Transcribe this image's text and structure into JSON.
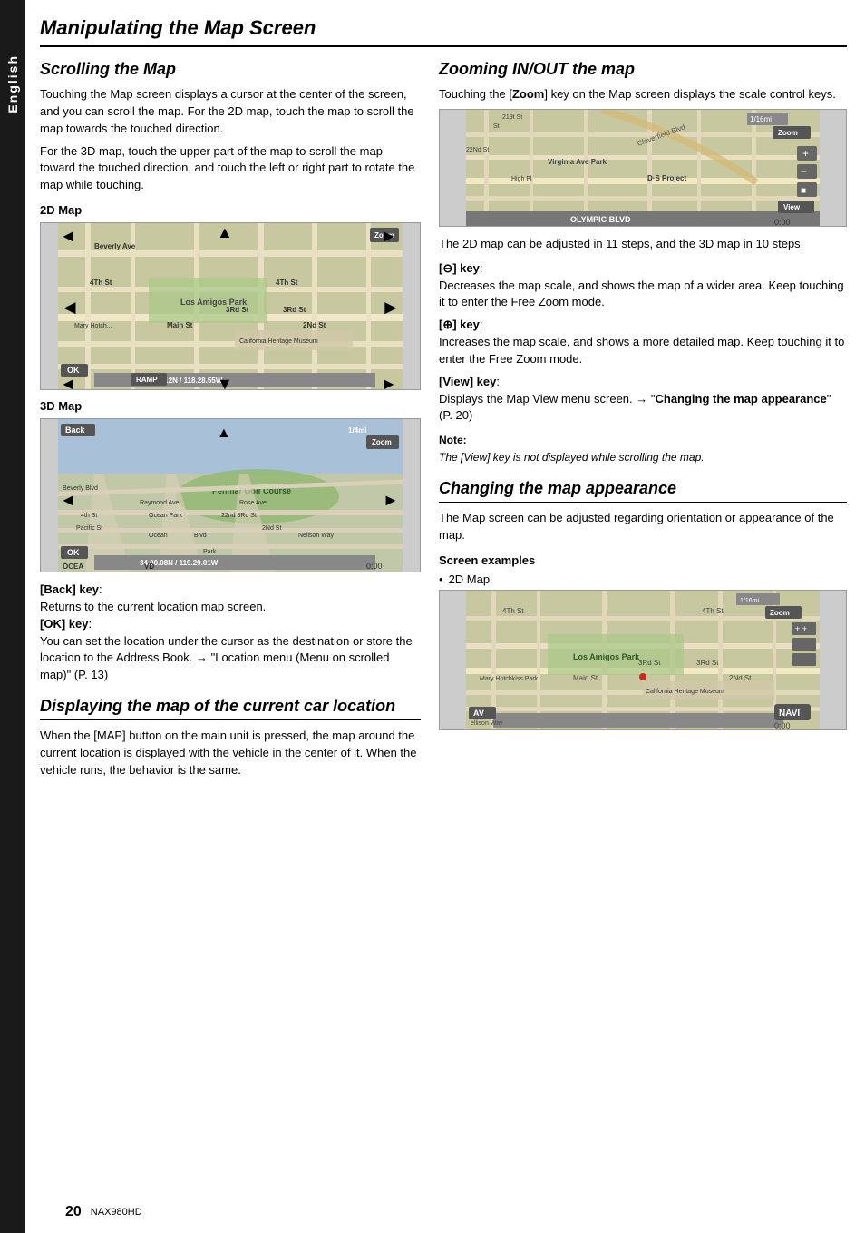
{
  "page": {
    "title": "Manipulating the Map Screen",
    "page_number": "20",
    "model": "NAX980HD"
  },
  "side_tab": {
    "label": "English"
  },
  "left_column": {
    "scrolling_title": "Scrolling the Map",
    "scrolling_text": "Touching the Map screen displays a cursor at the center of the screen, and you can scroll the map. For the 2D map, touch the map to scroll the map towards the touched direction.",
    "scrolling_text2": "For the 3D map, touch the upper part of the map to scroll the map toward the touched direction, and touch the left or right part to rotate the map while touching.",
    "map_2d_label": "2D Map",
    "map_3d_label": "3D Map",
    "back_key_label": "[Back] key",
    "back_key_text": "Returns to the current location map screen.",
    "ok_key_label": "[OK] key",
    "ok_key_text": "You can set the location under the cursor as the destination or store the location to the Address Book. → \"Location menu (Menu on scrolled map)\" (P. 13)",
    "displaying_title": "Displaying the map of the current car location",
    "displaying_text": "When the [MAP] button on the main unit is pressed, the map around the current location is displayed with the vehicle in the center of it. When the vehicle runs, the behavior is the same."
  },
  "right_column": {
    "zooming_title": "Zooming IN/OUT the map",
    "zooming_text": "Touching the [Zoom] key on the Map screen displays the scale control keys.",
    "zooming_text2": "The 2D map can be adjusted in 11 steps, and the 3D map in 10 steps.",
    "minus_key_label": "[⊖] key",
    "minus_key_text": "Decreases the map scale, and shows the map of a wider area. Keep touching it to enter the Free Zoom mode.",
    "plus_key_label": "[⊕] key",
    "plus_key_text": "Increases the map scale, and shows a more detailed map. Keep touching it to enter the Free Zoom mode.",
    "view_key_label": "[View] key",
    "view_key_text": "Displays the Map View menu screen. → \"Changing the map appearance\" (P. 20)",
    "note_title": "Note:",
    "note_text": "The [View] key is not displayed while scrolling the map.",
    "changing_title": "Changing the map appearance",
    "changing_text": "The Map screen can be adjusted regarding orientation or appearance of the map.",
    "screen_examples_label": "Screen examples",
    "map_2d_label": "2D Map"
  }
}
